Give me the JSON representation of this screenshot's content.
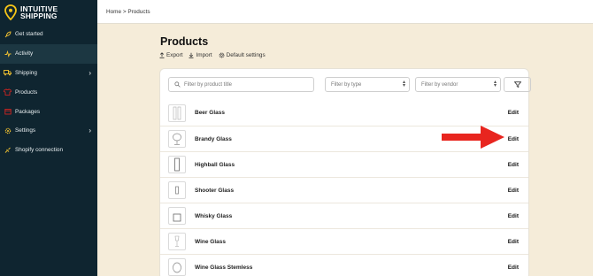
{
  "brand": {
    "line1": "INTUITIVE",
    "line2": "SHIPPING",
    "accent": "#f5c518"
  },
  "sidebar": {
    "items": [
      {
        "label": "Get started",
        "icon": "rocket-icon"
      },
      {
        "label": "Activity",
        "icon": "activity-icon",
        "active": true
      },
      {
        "label": "Shipping",
        "icon": "truck-icon",
        "chevron": true
      },
      {
        "label": "Products",
        "icon": "shirt-icon"
      },
      {
        "label": "Packages",
        "icon": "package-icon"
      },
      {
        "label": "Settings",
        "icon": "gear-icon",
        "chevron": true
      },
      {
        "label": "Shopify connection",
        "icon": "link-icon"
      }
    ]
  },
  "breadcrumb": "Home > Products",
  "page": {
    "title": "Products",
    "actions": {
      "export": "Export",
      "import": "Import",
      "default_settings": "Default settings"
    }
  },
  "filters": {
    "search_placeholder": "Filter by product title",
    "type_placeholder": "Filter by type",
    "vendor_placeholder": "Filter by vendor"
  },
  "products": [
    {
      "name": "Beer Glass",
      "edit": "Edit"
    },
    {
      "name": "Brandy Glass",
      "edit": "Edit"
    },
    {
      "name": "Highball Glass",
      "edit": "Edit"
    },
    {
      "name": "Shooter Glass",
      "edit": "Edit"
    },
    {
      "name": "Whisky Glass",
      "edit": "Edit"
    },
    {
      "name": "Wine Glass",
      "edit": "Edit"
    },
    {
      "name": "Wine Glass Stemless",
      "edit": "Edit"
    }
  ],
  "colors": {
    "sidebar_bg": "#0f2530",
    "page_bg": "#f5ecd9",
    "arrow": "#e8251f",
    "icon_yellow": "#f2c230"
  }
}
